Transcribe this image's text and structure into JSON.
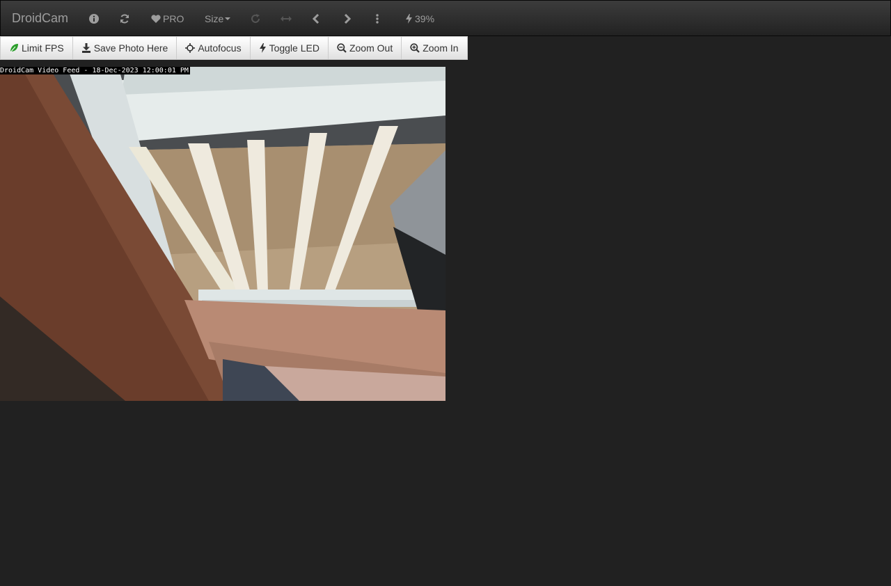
{
  "navbar": {
    "brand": "DroidCam",
    "pro_label": "PRO",
    "size_label": "Size",
    "battery_label": "39%",
    "icons": [
      "info-icon",
      "refresh-icon",
      "heart-icon",
      "rotate-icon",
      "flip-icon",
      "chevron-left-icon",
      "chevron-right-icon",
      "more-vertical-icon",
      "bolt-icon"
    ]
  },
  "toolbar": {
    "limit_fps": "Limit FPS",
    "save_photo": "Save Photo Here",
    "autofocus": "Autofocus",
    "toggle_led": "Toggle LED",
    "zoom_out": "Zoom Out",
    "zoom_in": "Zoom In"
  },
  "video": {
    "overlay_text": "DroidCam Video Feed - 18-Dec-2023 12:00:01 PM"
  },
  "colors": {
    "background": "#212121",
    "navbar": "#2d2d2d",
    "nav_text": "#9d9d9d",
    "leaf_icon": "#2a9d2a"
  }
}
